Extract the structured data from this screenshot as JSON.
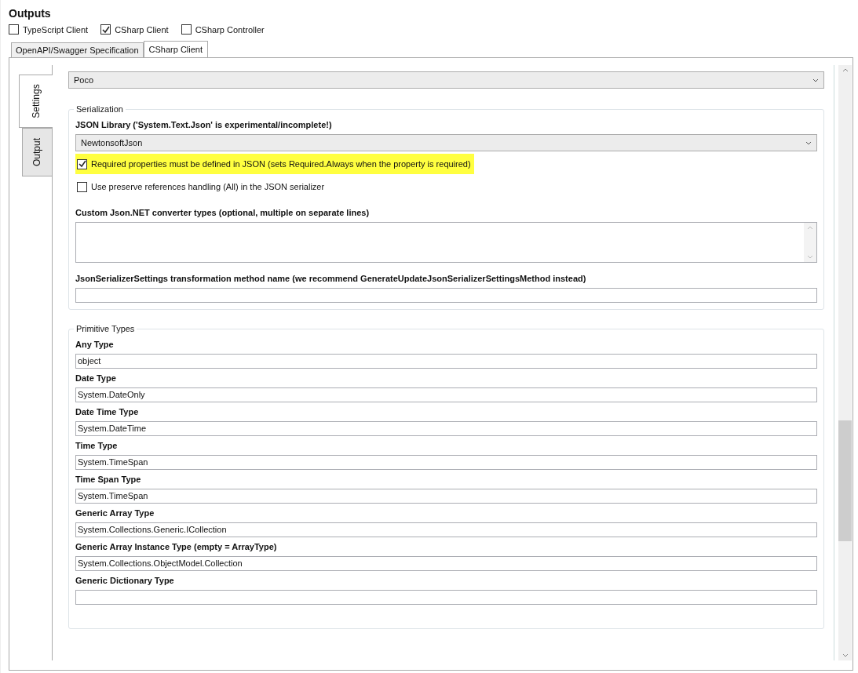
{
  "title": "Outputs",
  "outputs": [
    {
      "label": "TypeScript Client",
      "checked": false
    },
    {
      "label": "CSharp Client",
      "checked": true
    },
    {
      "label": "CSharp Controller",
      "checked": false
    }
  ],
  "tabs": [
    {
      "label": "OpenAPI/Swagger Specification",
      "selected": false
    },
    {
      "label": "CSharp Client",
      "selected": true
    }
  ],
  "side_tabs": [
    {
      "label": "Settings",
      "selected": true
    },
    {
      "label": "Output",
      "selected": false
    }
  ],
  "class_style": {
    "value": "Poco"
  },
  "serialization": {
    "title": "Serialization",
    "items": [
      {
        "kind": "combo",
        "label": "JSON Library ('System.Text.Json' is experimental/incomplete!)",
        "value": "NewtonsoftJson"
      },
      {
        "kind": "checkbox",
        "label": "Required properties must be defined in JSON (sets Required.Always when the property is required)",
        "checked": true,
        "highlighted": true
      },
      {
        "kind": "checkbox",
        "label": "Use preserve references handling (All) in the JSON serializer",
        "checked": false,
        "highlighted": false
      },
      {
        "kind": "textarea",
        "label": "Custom Json.NET converter types (optional, multiple on separate lines)"
      },
      {
        "kind": "text",
        "label": "JsonSerializerSettings transformation method name (we recommend GenerateUpdateJsonSerializerSettingsMethod instead)"
      }
    ]
  },
  "primitive_types": {
    "title": "Primitive Types",
    "items": [
      {
        "label": "Any Type",
        "value": "object"
      },
      {
        "label": "Date Type",
        "value": "System.DateOnly"
      },
      {
        "label": "Date Time Type",
        "value": "System.DateTime"
      },
      {
        "label": "Time Type",
        "value": "System.TimeSpan"
      },
      {
        "label": "Time Span Type",
        "value": "System.TimeSpan"
      },
      {
        "label": "Generic Array Type",
        "value": "System.Collections.Generic.ICollection"
      },
      {
        "label": "Generic Array Instance Type (empty = ArrayType)",
        "value": "System.Collections.ObjectModel.Collection"
      },
      {
        "label": "Generic Dictionary Type"
      }
    ]
  }
}
